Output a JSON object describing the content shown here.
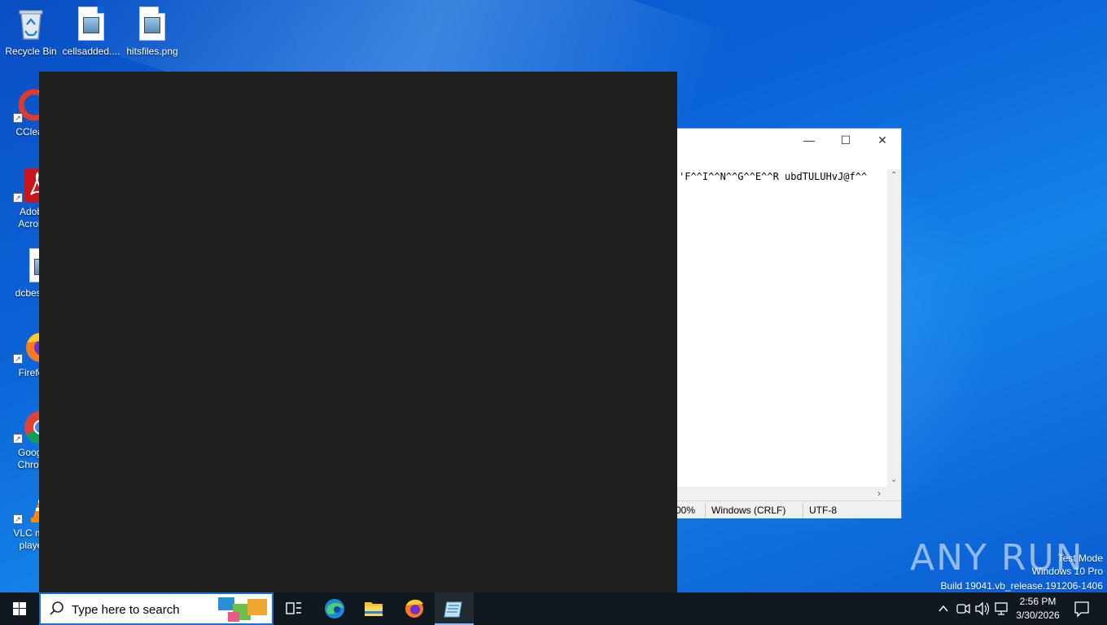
{
  "desktop": {
    "icons": [
      {
        "label": "Recycle Bin"
      },
      {
        "label": "cellsadded...."
      },
      {
        "label": "hitsfiles.png"
      },
      {
        "label": "CClear"
      },
      {
        "label": "Adob",
        "label2": "Acrob"
      },
      {
        "label": "dcbest."
      },
      {
        "label": "Firefo"
      },
      {
        "label": "Googl",
        "label2": "Chron"
      },
      {
        "label": "VLC me",
        "label2": "playe"
      }
    ]
  },
  "notepad": {
    "minimize": "—",
    "maximize": "☐",
    "close": "✕",
    "content": "'F^^I^^N^^G^^E^^R ubdTULUHvJ@f^^",
    "status": {
      "zoom": "00%",
      "line_ending": "Windows (CRLF)",
      "encoding": "UTF-8"
    }
  },
  "watermark": {
    "brand": "ANY RUN",
    "line1": "Test Mode",
    "line2": "Windows 10 Pro",
    "line3": "Build 19041.vb_release.191206-1406"
  },
  "taskbar": {
    "search_placeholder": "Type here to search",
    "time": "2:56 PM",
    "date": "3/30/2026"
  }
}
